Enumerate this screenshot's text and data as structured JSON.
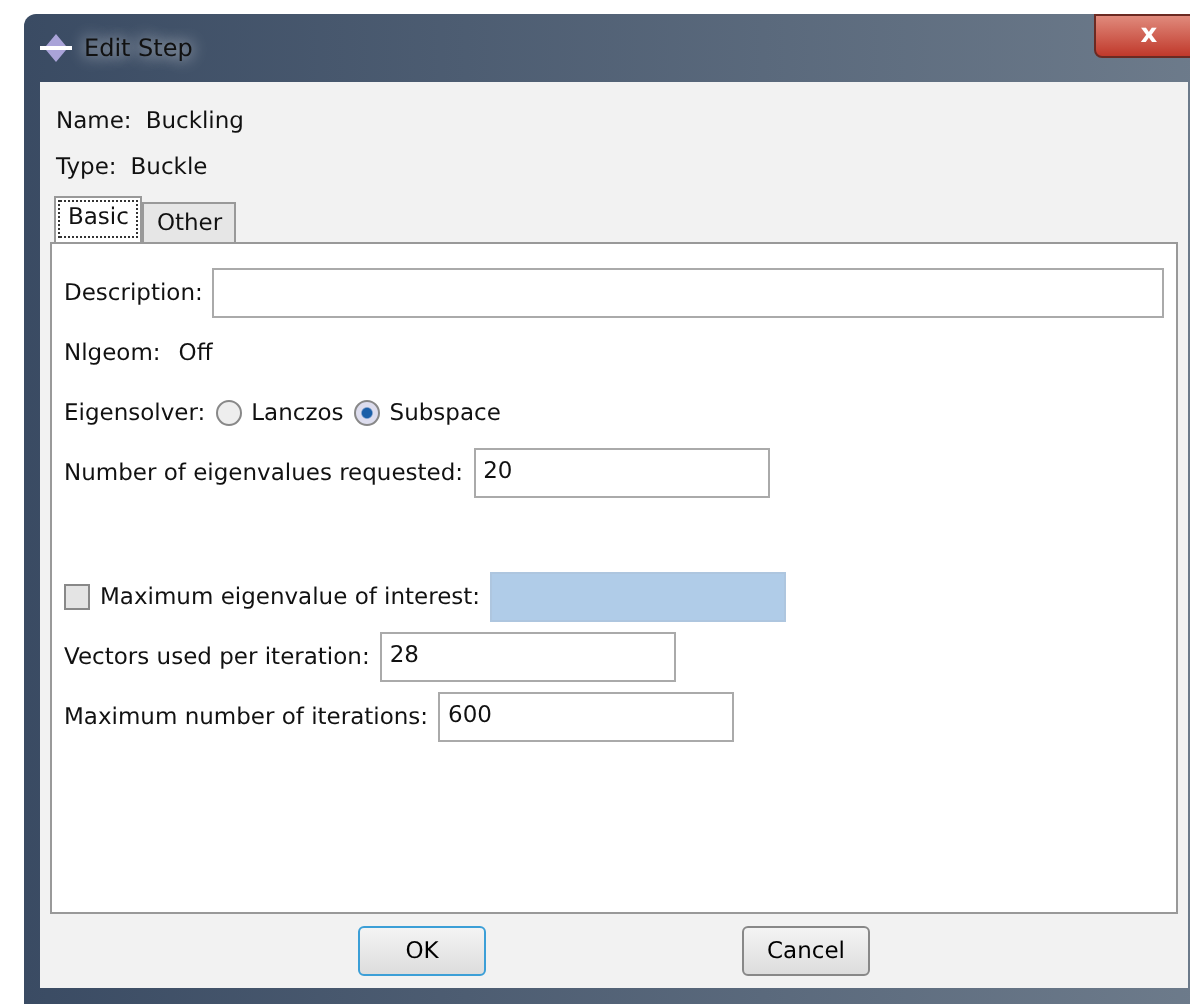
{
  "window": {
    "title": "Edit Step",
    "close": "x"
  },
  "info": [
    {
      "label": "Name:",
      "value": "Buckling"
    },
    {
      "label": "Type:",
      "value": "Buckle"
    }
  ],
  "tabs": [
    {
      "label": "Basic",
      "selected": true
    },
    {
      "label": "Other",
      "selected": false
    }
  ],
  "rows": [
    {
      "kind": "longfield",
      "label": "Description:",
      "value": ""
    },
    {
      "kind": "text",
      "label": "Nlgeom:",
      "value": "Off"
    },
    {
      "kind": "radio",
      "label": "Eigensolver:",
      "options": [
        {
          "label": "Lanczos",
          "selected": false
        },
        {
          "label": "Subspace",
          "selected": true
        }
      ]
    },
    {
      "kind": "field",
      "label": "Number of eigenvalues requested:",
      "value": "20"
    },
    {
      "kind": "gap"
    },
    {
      "kind": "check",
      "label": "Maximum eigenvalue of interest:",
      "checked": false,
      "disabled": true
    },
    {
      "kind": "field",
      "label": "Vectors used per iteration:",
      "value": "28"
    },
    {
      "kind": "field",
      "label": "Maximum number of iterations:",
      "value": "600"
    }
  ],
  "buttons": [
    {
      "label": "OK",
      "default": true
    },
    {
      "label": "Cancel",
      "default": false
    }
  ]
}
